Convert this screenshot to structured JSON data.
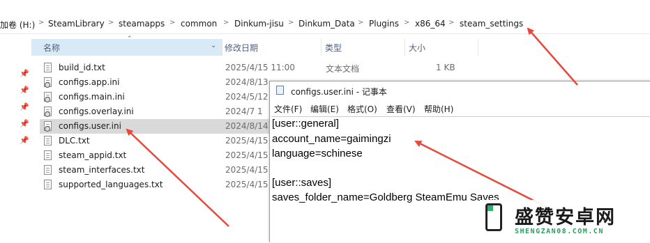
{
  "breadcrumb": [
    "加卷 (H:)",
    "SteamLibrary",
    "steamapps",
    "common",
    "Dinkum-jisu",
    "Dinkum_Data",
    "Plugins",
    "x86_64",
    "steam_settings"
  ],
  "columns": {
    "name": "名称",
    "modified": "修改日期",
    "type": "类型",
    "size": "大小"
  },
  "files": [
    {
      "name": "build_id.txt",
      "date": "2025/4/15 11:00",
      "type": "文本文档",
      "size": "1 KB",
      "icon": "text-file-icon"
    },
    {
      "name": "configs.app.ini",
      "date": "2024/8/13",
      "icon": "config-file-icon"
    },
    {
      "name": "configs.main.ini",
      "date": "2024/5/12",
      "icon": "config-file-icon"
    },
    {
      "name": "configs.overlay.ini",
      "date": "2024/7 1",
      "icon": "config-file-icon"
    },
    {
      "name": "configs.user.ini",
      "date": "2024/8/14",
      "icon": "config-file-icon",
      "selected": true
    },
    {
      "name": "DLC.txt",
      "date": "2025/4/15",
      "icon": "text-file-icon"
    },
    {
      "name": "steam_appid.txt",
      "date": "2025/4/15",
      "icon": "text-file-icon"
    },
    {
      "name": "steam_interfaces.txt",
      "date": "2025/4/15",
      "icon": "text-file-icon"
    },
    {
      "name": "supported_languages.txt",
      "date": "2025/4/15",
      "icon": "text-file-icon"
    }
  ],
  "notepad": {
    "title": "configs.user.ini - 记事本",
    "menu": [
      "文件(F)",
      "编辑(E)",
      "格式(O)",
      "查看(V)",
      "帮助(H)"
    ],
    "lines": [
      "[user::general]",
      "account_name=gaimingzi",
      "language=schinese",
      "",
      "[user::saves]",
      "saves_folder_name=Goldberg SteamEmu Saves"
    ]
  },
  "watermark": {
    "cn": "盛赞安卓网",
    "en": "SHENGZAN08.COM.CN"
  },
  "colors": {
    "arrow": "#e8473a",
    "selected_row": "#d9d9d9",
    "header_highlight": "#d9eaf7",
    "watermark_green": "#2a9d5c"
  }
}
